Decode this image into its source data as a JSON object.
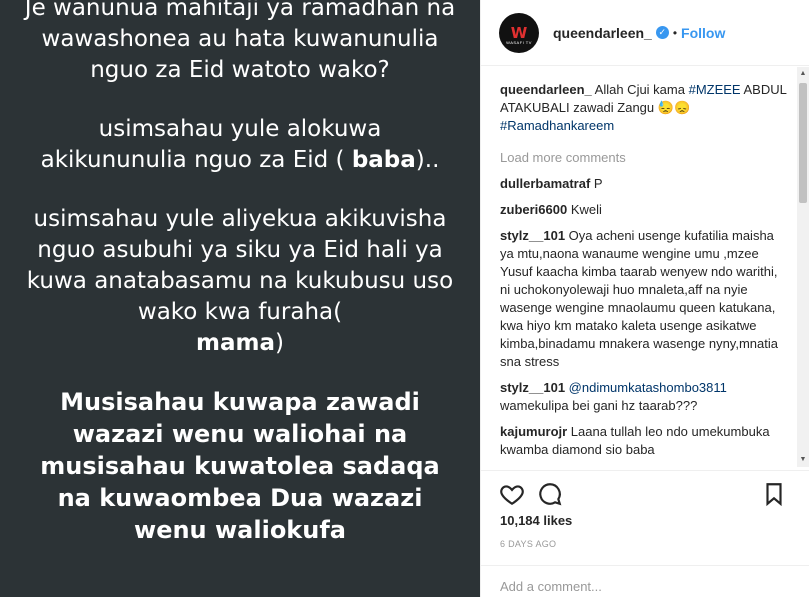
{
  "image": {
    "line1": "Je wanunua mahitaji ya ramadhan na wawashonea au hata kuwanunulia nguo za Eid watoto wako?",
    "para2_pre": "usimsahau yule alokuwa akikununulia nguo za Eid ( ",
    "para2_bold": "baba",
    "para2_post": ")..",
    "para3": "usimsahau yule aliyekua akikuvisha nguo asubuhi ya siku ya Eid hali ya kuwa anatabasamu na kukubusu uso wako kwa furaha(",
    "para3_bold": "mama",
    "para3_post": ")",
    "para4": "Musisahau kuwapa zawadi wazazi wenu waliohai na musisahau kuwatolea sadaqa na kuwaombea Dua wazazi wenu waliokufa"
  },
  "header": {
    "username": "queendarleen_",
    "verified_glyph": "✓",
    "dot": "•",
    "follow_label": "Follow",
    "avatar_logo": "W",
    "avatar_sub": "WASAFI TV"
  },
  "caption": {
    "user": "queendarleen_",
    "text_pre": " Allah Cjui kama ",
    "tag1": "#MZEEE",
    "text_mid": " ABDUL ATAKUBALI zawadi Zangu 😓😞 ",
    "tag2": "#Ramadhankareem"
  },
  "load_more": "Load more comments",
  "comments": [
    {
      "user": "dullerbamatraf",
      "text": " P"
    },
    {
      "user": "zuberi6600",
      "text": " Kweli"
    },
    {
      "user": "stylz__101",
      "text": " Oya acheni usenge kufatilia maisha ya mtu,naona wanaume wengine umu ,mzee Yusuf kaacha kimba taarab wenyew ndo warithi, ni uchokonyolewaji huo mnaleta,aff na nyie wasenge wengine mnaolaumu queen katukana, kwa hiyo km matako kaleta usenge asikatwe kimba,binadamu mnakera wasenge nyny,mnatia sna stress"
    },
    {
      "user": "stylz__101",
      "mention": " @ndimumkatashombo3811",
      "text": " wamekulipa bei gani hz taarab???"
    },
    {
      "user": "kajumurojr",
      "text": " Laana tullah leo ndo umekumbuka kwamba diamond sio baba"
    }
  ],
  "scrollbar": {
    "up": "▲",
    "down": "▼"
  },
  "likes": "10,184 likes",
  "time_ago": "6 DAYS AGO",
  "add_comment_placeholder": "Add a comment..."
}
